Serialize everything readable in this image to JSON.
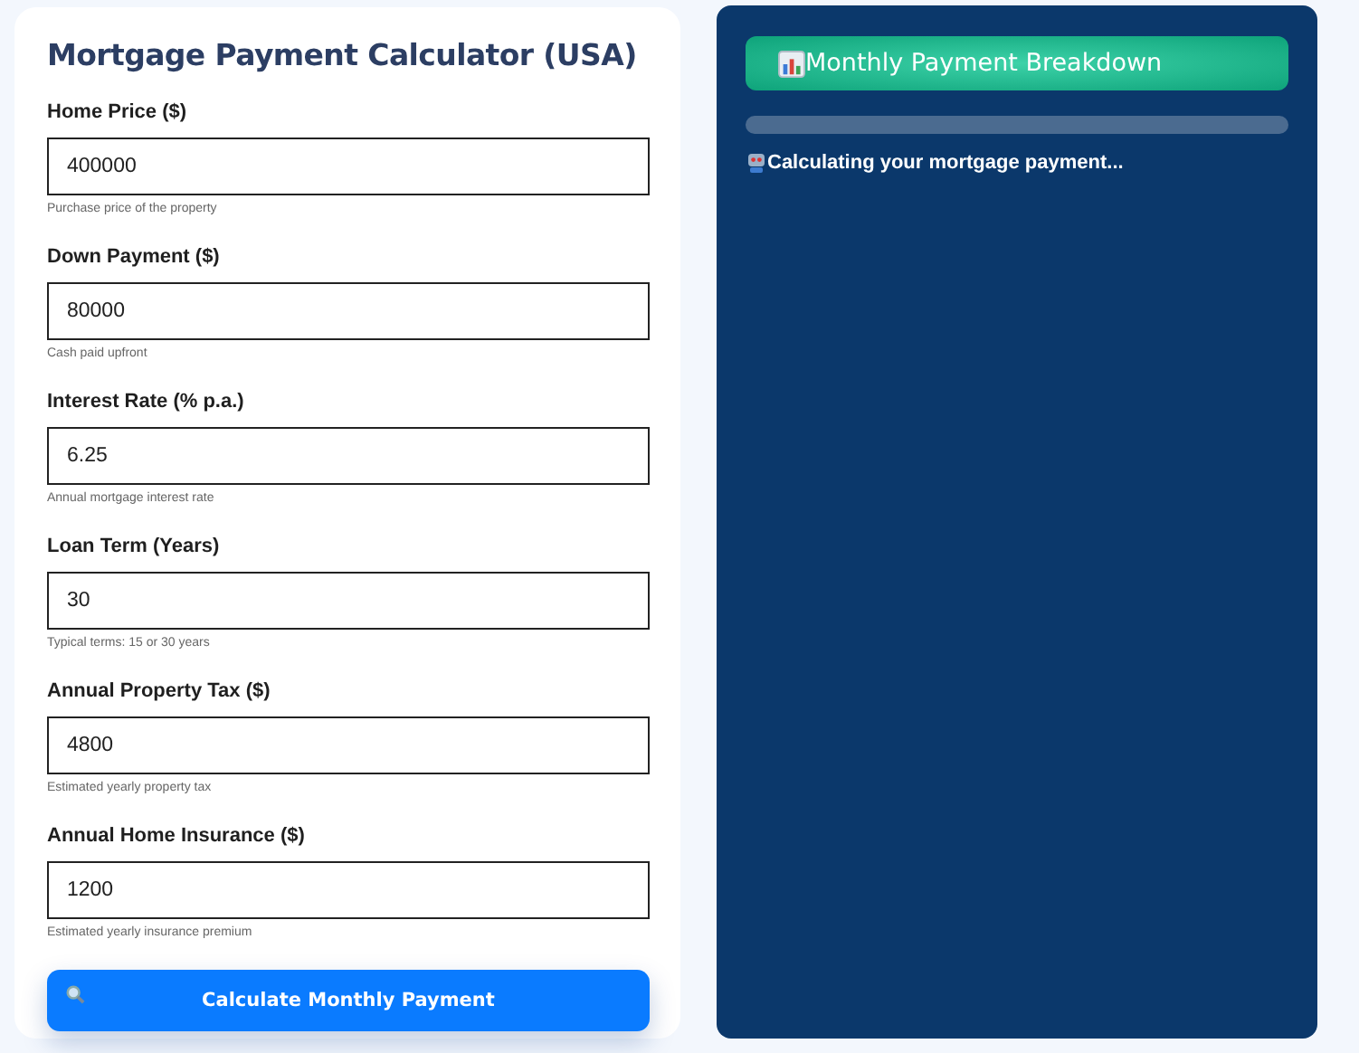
{
  "calculator": {
    "title": "Mortgage Payment Calculator (USA)",
    "fields": [
      {
        "label": "Home Price ($)",
        "value": "400000",
        "hint": "Purchase price of the property"
      },
      {
        "label": "Down Payment ($)",
        "value": "80000",
        "hint": "Cash paid upfront"
      },
      {
        "label": "Interest Rate (% p.a.)",
        "value": "6.25",
        "hint": "Annual mortgage interest rate"
      },
      {
        "label": "Loan Term (Years)",
        "value": "30",
        "hint": "Typical terms: 15 or 30 years"
      },
      {
        "label": "Annual Property Tax ($)",
        "value": "4800",
        "hint": "Estimated yearly property tax"
      },
      {
        "label": "Annual Home Insurance ($)",
        "value": "1200",
        "hint": "Estimated yearly insurance premium"
      }
    ],
    "button": "Calculate Monthly Payment"
  },
  "breakdown": {
    "title": "Monthly Payment Breakdown",
    "progress": {
      "level": 0
    },
    "status": "Calculating your mortgage payment..."
  }
}
